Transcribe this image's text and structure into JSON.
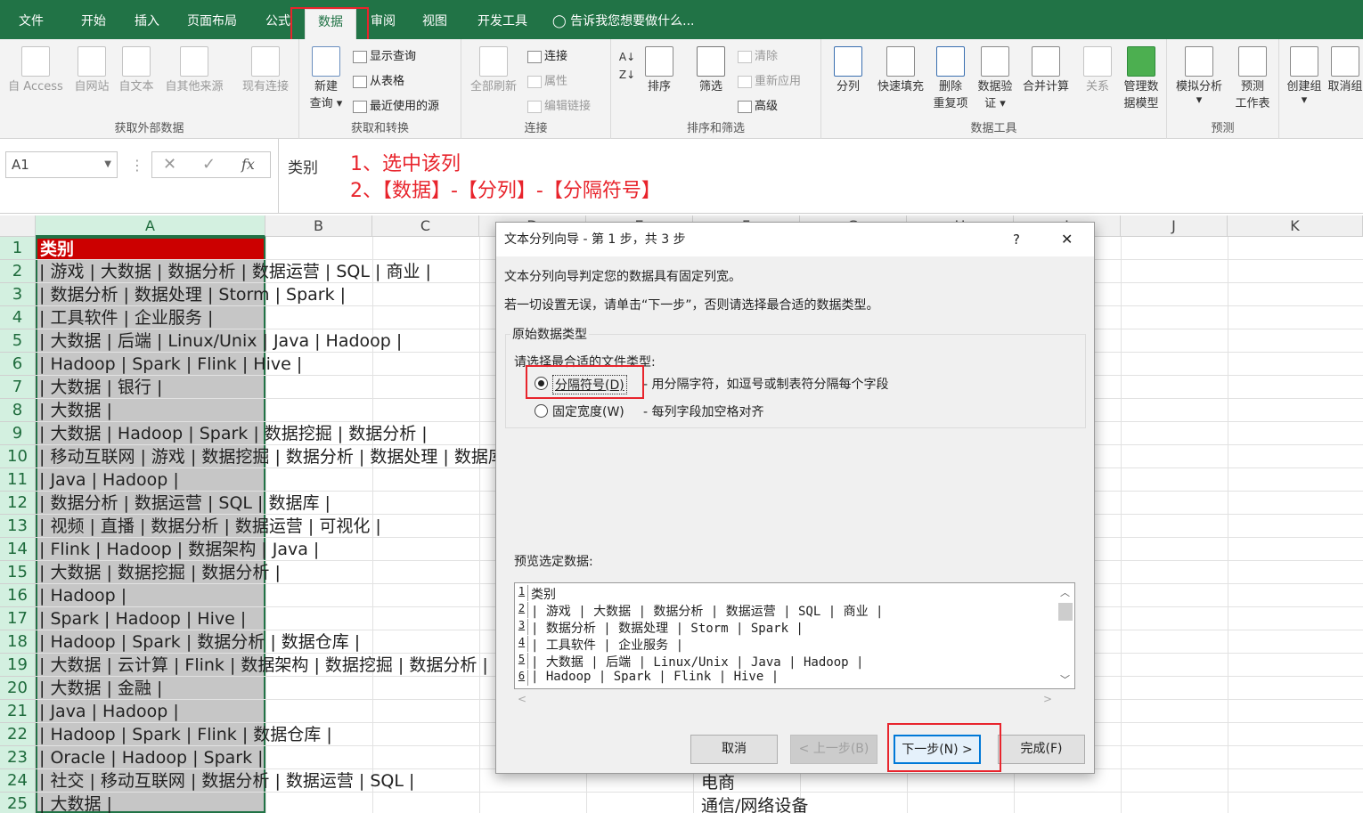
{
  "tabs": [
    "文件",
    "开始",
    "插入",
    "页面布局",
    "公式",
    "数据",
    "审阅",
    "视图",
    "开发工具"
  ],
  "tell_me": "告诉我您想要做什么...",
  "ribbon": {
    "get_external": {
      "label": "获取外部数据",
      "items": [
        "自 Access",
        "自网站",
        "自文本",
        "自其他来源",
        "现有连接"
      ]
    },
    "get_transform": {
      "label": "获取和转换",
      "new_query_1": "新建",
      "new_query_2": "查询",
      "show_query": "显示查询",
      "from_table": "从表格",
      "recent_sources": "最近使用的源"
    },
    "connections": {
      "label": "连接",
      "refresh_all": "全部刷新",
      "connections": "连接",
      "properties": "属性",
      "edit_links": "编辑链接"
    },
    "sort_filter": {
      "label": "排序和筛选",
      "sort": "排序",
      "filter": "筛选",
      "clear": "清除",
      "reapply": "重新应用",
      "advanced": "高级"
    },
    "data_tools": {
      "label": "数据工具",
      "text_to_columns": "分列",
      "flash_fill": "快速填充",
      "remove_dup_1": "删除",
      "remove_dup_2": "重复项",
      "validation_1": "数据验",
      "validation_2": "证",
      "consolidate": "合并计算",
      "relationships": "关系",
      "data_model_1": "管理数",
      "data_model_2": "据模型"
    },
    "forecast": {
      "label": "预测",
      "what_if": "模拟分析",
      "forecast_1": "预测",
      "forecast_2": "工作表"
    },
    "outline": {
      "group": "创建组",
      "ungroup": "取消组"
    }
  },
  "formula_bar": {
    "name_box": "A1",
    "content": "类别",
    "fx": "fx"
  },
  "annotations": {
    "step1": "1、选中该列",
    "step2": "2、【数据】-【分列】-【分隔符号】"
  },
  "columns": [
    "A",
    "B",
    "C",
    "D",
    "E",
    "F",
    "G",
    "H",
    "I",
    "J",
    "K"
  ],
  "rows": [
    {
      "n": "1",
      "a": "类别"
    },
    {
      "n": "2",
      "a": "| 游戏 | 大数据 | 数据分析 | 数据运营 | SQL | 商业 |"
    },
    {
      "n": "3",
      "a": "| 数据分析 | 数据处理 | Storm | Spark |"
    },
    {
      "n": "4",
      "a": "| 工具软件 | 企业服务 |"
    },
    {
      "n": "5",
      "a": "| 大数据 | 后端 | Linux/Unix | Java | Hadoop |"
    },
    {
      "n": "6",
      "a": "| Hadoop | Spark | Flink | Hive |"
    },
    {
      "n": "7",
      "a": "| 大数据 | 银行 |"
    },
    {
      "n": "8",
      "a": "| 大数据 |"
    },
    {
      "n": "9",
      "a": "| 大数据 | Hadoop | Spark | 数据挖掘 | 数据分析 |"
    },
    {
      "n": "10",
      "a": "| 移动互联网 | 游戏 | 数据挖掘 | 数据分析 | 数据处理 | 数据库"
    },
    {
      "n": "11",
      "a": "| Java | Hadoop |"
    },
    {
      "n": "12",
      "a": "| 数据分析 | 数据运营 | SQL | 数据库 |"
    },
    {
      "n": "13",
      "a": "| 视频 | 直播 | 数据分析 | 数据运营 | 可视化 |"
    },
    {
      "n": "14",
      "a": "| Flink | Hadoop | 数据架构 | Java |"
    },
    {
      "n": "15",
      "a": "| 大数据 | 数据挖掘 | 数据分析 |"
    },
    {
      "n": "16",
      "a": "| Hadoop |"
    },
    {
      "n": "17",
      "a": "| Spark | Hadoop | Hive |"
    },
    {
      "n": "18",
      "a": "| Hadoop | Spark | 数据分析 | 数据仓库 |"
    },
    {
      "n": "19",
      "a": "| 大数据 | 云计算 | Flink | 数据架构 | 数据挖掘 | 数据分析 |"
    },
    {
      "n": "20",
      "a": "| 大数据 | 金融 |"
    },
    {
      "n": "21",
      "a": "| Java | Hadoop |"
    },
    {
      "n": "22",
      "a": "| Hadoop | Spark | Flink | 数据仓库 |"
    },
    {
      "n": "23",
      "a": "| Oracle | Hadoop | Spark |"
    },
    {
      "n": "24",
      "a": "| 社交 | 移动互联网 | 数据分析 | 数据运营 | SQL |"
    },
    {
      "n": "25",
      "a": "| 大数据 |"
    }
  ],
  "column_f": {
    "r24": "电商",
    "r25": "通信/网络设备"
  },
  "dialog": {
    "title": "文本分列向导 - 第 1 步，共 3 步",
    "help": "?",
    "close": "✕",
    "desc1": "文本分列向导判定您的数据具有固定列宽。",
    "desc2": "若一切设置无误，请单击“下一步”，否则请选择最合适的数据类型。",
    "group_label": "原始数据类型",
    "choose_label": "请选择最合适的文件类型:",
    "opt1_label": "分隔符号(D)",
    "opt1_desc": "- 用分隔字符，如逗号或制表符分隔每个字段",
    "opt2_label": "固定宽度(W)",
    "opt2_desc": "- 每列字段加空格对齐",
    "preview_label": "预览选定数据:",
    "preview": [
      {
        "n": "1",
        "t": "类别"
      },
      {
        "n": "2",
        "t": "| 游戏 | 大数据 | 数据分析 | 数据运营 | SQL | 商业 |"
      },
      {
        "n": "3",
        "t": "| 数据分析 | 数据处理 | Storm | Spark |"
      },
      {
        "n": "4",
        "t": "| 工具软件 | 企业服务 |"
      },
      {
        "n": "5",
        "t": "| 大数据 | 后端 | Linux/Unix | Java | Hadoop |"
      },
      {
        "n": "6",
        "t": "| Hadoop | Spark | Flink | Hive |"
      }
    ],
    "buttons": {
      "cancel": "取消",
      "back": "< 上一步(B)",
      "next": "下一步(N) >",
      "finish": "完成(F)"
    }
  },
  "colors": {
    "excel_green": "#217346",
    "highlight_red": "#e8242c",
    "header_red": "#cc0000"
  }
}
